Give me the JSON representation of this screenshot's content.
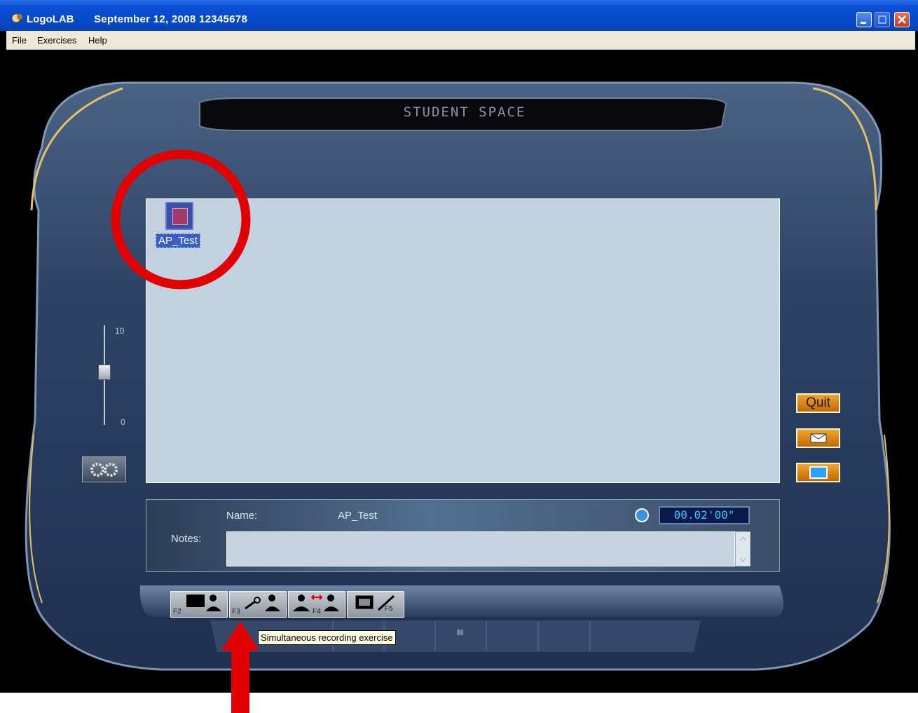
{
  "title": {
    "app_name": "LogoLAB",
    "info": "September 12, 2008  12345678"
  },
  "menu": {
    "items": [
      "File",
      "Exercises",
      "Help"
    ]
  },
  "header": {
    "label": "STUDENT SPACE"
  },
  "workspace": {
    "files": [
      {
        "label": "AP_Test",
        "icon": "audio-exercise-icon",
        "selected": true
      }
    ]
  },
  "volume": {
    "max_label": "10",
    "min_label": "0",
    "level": 5
  },
  "info": {
    "name_label": "Name:",
    "name_value": "AP_Test",
    "notes_label": "Notes:",
    "notes_value": "",
    "timer_value": "00.02'00\""
  },
  "side_buttons": {
    "quit_label": "Quit",
    "mail_icon": "envelope-icon",
    "screen_icon": "monitor-icon"
  },
  "toolbar": {
    "buttons": [
      {
        "key": "F2",
        "icon": "monitor-student-icon"
      },
      {
        "key": "F3",
        "icon": "microphone-student-icon"
      },
      {
        "key": "F4",
        "icon": "student-exchange-icon"
      },
      {
        "key": "F5",
        "icon": "screen-pencil-icon"
      }
    ],
    "tooltip": "Simultaneous recording exercise"
  },
  "annotations": {
    "highlight_color": "#e10000"
  },
  "colors": {
    "titlebar": "#0549c6",
    "device_body": "#2a3c5a",
    "workarea_bg": "#c1d1df",
    "quit_button": "#e08a14",
    "timer_text": "#36c6ff"
  }
}
